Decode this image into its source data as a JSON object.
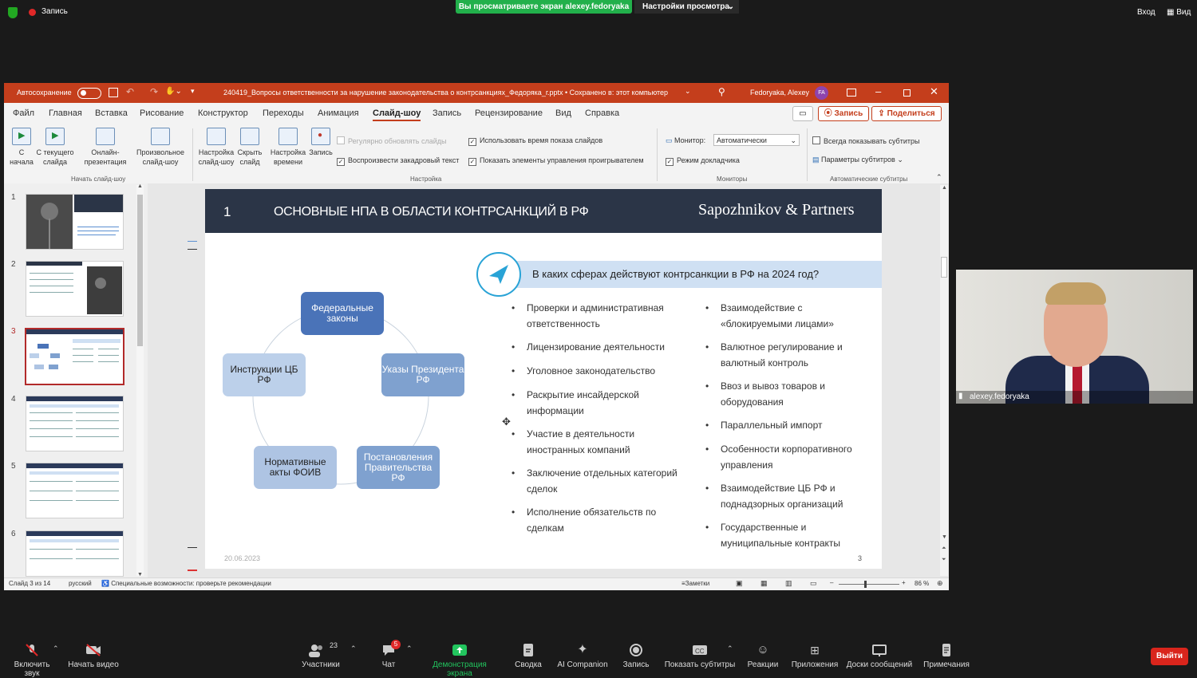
{
  "zoom": {
    "recording_label": "Запись",
    "share_banner": "Вы просматриваете экран alexey.fedoryaka",
    "view_options": "Настройки просмотра",
    "enter_label": "Вход",
    "view_label": "Вид",
    "toolbar": {
      "unmute": "Включить звук",
      "start_video": "Начать видео",
      "participants": "Участники",
      "participants_count": "23",
      "chat": "Чат",
      "chat_badge": "5",
      "share_screen": "Демонстрация экрана",
      "summary": "Сводка",
      "ai_companion": "AI Companion",
      "record": "Запись",
      "captions": "Показать субтитры",
      "reactions": "Реакции",
      "apps": "Приложения",
      "whiteboards": "Доски сообщений",
      "notes": "Примечания",
      "leave": "Выйти"
    },
    "camera_name": "alexey.fedoryaka"
  },
  "ppt": {
    "autosave": "Автосохранение",
    "doc_title": "240419_Вопросы ответственности за нарушение законодательства о контрсанкциях_Федоряка_г.pptx • Сохранено в: этот компьютер",
    "user_name": "Fedoryaka, Alexey",
    "user_initials": "FA",
    "tabs": [
      "Файл",
      "Главная",
      "Вставка",
      "Рисование",
      "Конструктор",
      "Переходы",
      "Анимация",
      "Слайд-шоу",
      "Запись",
      "Рецензирование",
      "Вид",
      "Справка"
    ],
    "active_tab": "Слайд-шоу",
    "record_btn": "Запись",
    "share_btn": "Поделиться",
    "ribbon": {
      "from_start": "С начала",
      "from_current": "С текущего слайда",
      "online": "Онлайн-презентация",
      "custom": "Произвольное слайд-шоу",
      "group_start": "Начать слайд-шоу",
      "setup": "Настройка слайд-шоу",
      "hide": "Скрыть слайд",
      "rehearse": "Настройка времени",
      "record": "Запись",
      "chk_narration_reg": "Регулярно обновлять слайды",
      "chk_narration": "Воспроизвести закадровый текст",
      "chk_timings": "Использовать время показа слайдов",
      "chk_media": "Показать элементы управления проигрывателем",
      "group_setup": "Настройка",
      "monitor_label": "Монитор:",
      "monitor_value": "Автоматически",
      "presenter_view": "Режим докладчика",
      "group_monitors": "Мониторы",
      "always_subs": "Всегда показывать субтитры",
      "subs_settings": "Параметры субтитров",
      "group_subs": "Автоматические субтитры"
    },
    "thumb_numbers": [
      "1",
      "2",
      "3",
      "4",
      "5",
      "6"
    ],
    "status": {
      "slide_info": "Слайд 3 из 14",
      "language": "русский",
      "accessibility": "Специальные возможности: проверьте рекомендации",
      "notes": "Заметки",
      "zoom": "86 %"
    }
  },
  "slide": {
    "number": "1",
    "title": "ОСНОВНЫЕ НПА В ОБЛАСТИ КОНТРСАНКЦИЙ В РФ",
    "brand": "Sapozhnikov & Partners",
    "question": "В каких сферах действуют контрсанкции в РФ на 2024 год?",
    "cycle": {
      "federal": "Федеральные законы",
      "decrees": "Указы Президента РФ",
      "gov": "Постановления Правительства РФ",
      "foiv": "Нормативные акты ФОИВ",
      "cb": "Инструкции ЦБ РФ"
    },
    "left_bullets": [
      "Проверки и административная ответственность",
      "Лицензирование деятельности",
      "Уголовное законодательство",
      "Раскрытие инсайдерской информации",
      "Участие в деятельности иностранных компаний",
      "Заключение отдельных категорий сделок",
      "Исполнение обязательств по сделкам"
    ],
    "right_bullets": [
      "Взаимодействие с «блокируемыми лицами»",
      "Валютное регулирование и валютный контроль",
      "Ввоз и вывоз товаров и оборудования",
      "Параллельный импорт",
      "Особенности корпоративного управления",
      "Взаимодействие ЦБ РФ и поднадзорных организаций",
      "Государственные и муниципальные контракты"
    ],
    "date": "20.06.2023",
    "page": "3"
  }
}
